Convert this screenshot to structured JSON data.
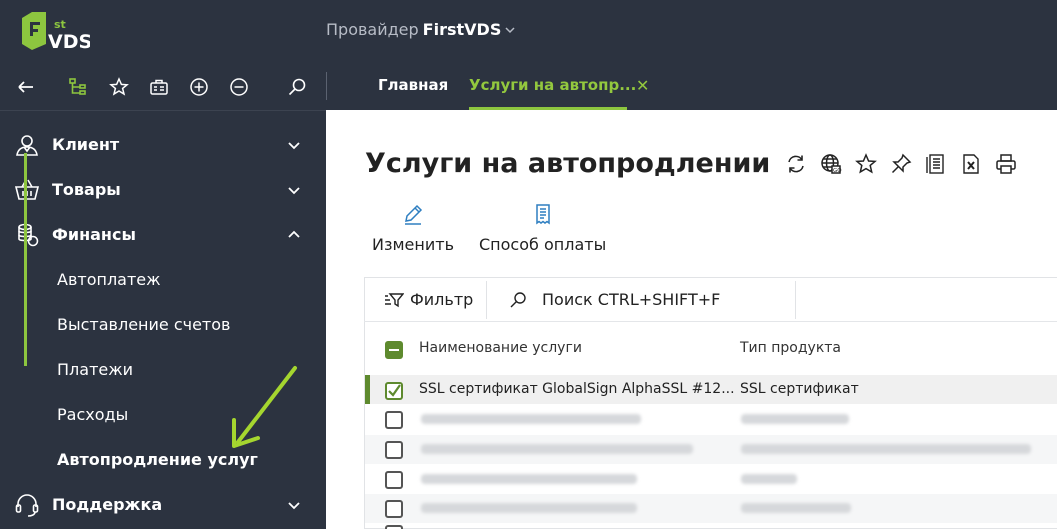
{
  "header": {
    "provider_prefix": "Провайдер",
    "provider_name": "FirstVDS",
    "logo_text_top": "st",
    "logo_text": "VDS"
  },
  "toolbar": {
    "icons": [
      "back-icon",
      "tree-icon",
      "star-icon",
      "briefcase-icon",
      "plus-circle-icon",
      "minus-circle-icon",
      "search-icon"
    ]
  },
  "tabs": [
    {
      "label": "Главная",
      "active": false
    },
    {
      "label": "Услуги на автопр...",
      "active": true,
      "closable": true
    }
  ],
  "sidebar": {
    "items": [
      {
        "label": "Клиент",
        "icon": "user-icon",
        "expanded": false
      },
      {
        "label": "Товары",
        "icon": "basket-icon",
        "expanded": false
      },
      {
        "label": "Финансы",
        "icon": "coins-icon",
        "expanded": true
      },
      {
        "label": "Поддержка",
        "icon": "headset-icon",
        "expanded": false
      }
    ],
    "finance_sub": [
      {
        "label": "Автоплатеж",
        "active": false
      },
      {
        "label": "Выставление счетов",
        "active": false
      },
      {
        "label": "Платежи",
        "active": false
      },
      {
        "label": "Расходы",
        "active": false
      },
      {
        "label": "Автопродление услуг",
        "active": true
      }
    ]
  },
  "page": {
    "title": "Услуги на автопродлении",
    "title_icons": [
      "refresh-icon",
      "globe-icon",
      "star-icon",
      "pin-icon",
      "document-icon",
      "excel-icon",
      "print-icon"
    ],
    "actions": [
      {
        "label": "Изменить",
        "icon": "pencil-icon"
      },
      {
        "label": "Способ оплаты",
        "icon": "receipt-icon"
      }
    ]
  },
  "filter_bar": {
    "filter_label": "Фильтр",
    "search_placeholder": "Поиск CTRL+SHIFT+F"
  },
  "table": {
    "columns": [
      "Наименование услуги",
      "Тип продукта"
    ],
    "rows": [
      {
        "name": "SSL сертификат GlobalSign AlphaSSL #12...",
        "type": "SSL сертификат",
        "checked": true,
        "blurred": false
      },
      {
        "name": "",
        "type": "",
        "checked": false,
        "blurred": true
      },
      {
        "name": "",
        "type": "",
        "checked": false,
        "blurred": true
      },
      {
        "name": "",
        "type": "",
        "checked": false,
        "blurred": true
      },
      {
        "name": "",
        "type": "",
        "checked": false,
        "blurred": true
      },
      {
        "name": "",
        "type": "",
        "checked": false,
        "blurred": true
      }
    ]
  },
  "colors": {
    "sidebar_bg": "#2c3340",
    "accent_green": "#8dc63f",
    "checkbox_green": "#5e8a2e"
  }
}
